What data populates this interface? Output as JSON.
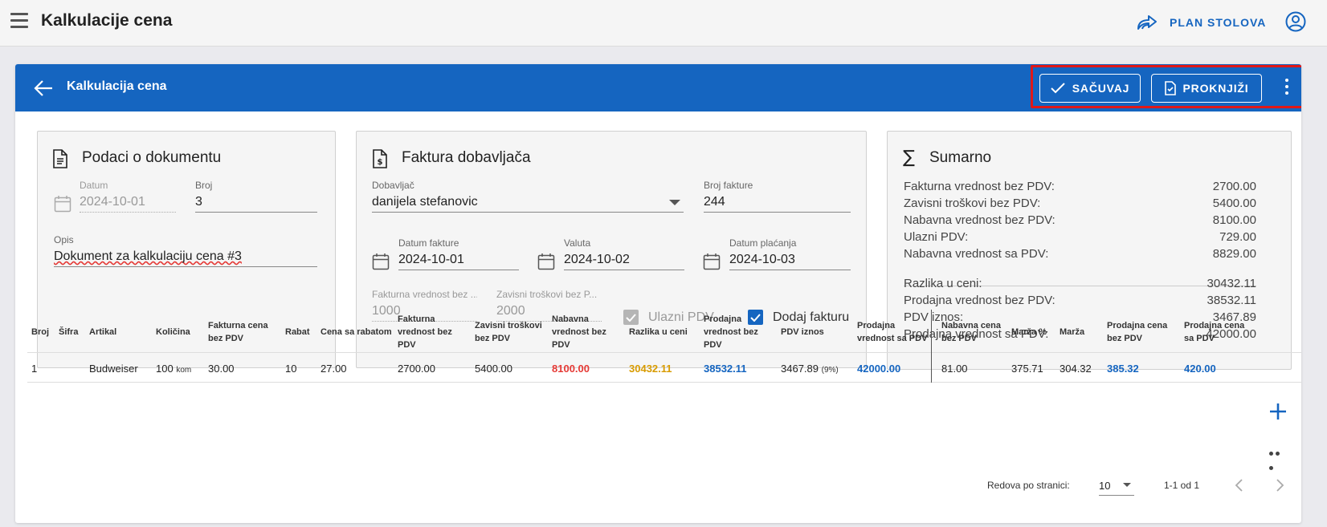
{
  "appbar": {
    "title": "Kalkulacije cena",
    "plan_label": "PLAN STOLOVA"
  },
  "header": {
    "title": "Kalkulacija cena",
    "save_label": "SAČUVAJ",
    "book_label": "PROKNJIŽI"
  },
  "doc": {
    "title": "Podaci o dokumentu",
    "datum_label": "Datum",
    "datum_value": "2024-10-01",
    "broj_label": "Broj",
    "broj_value": "3",
    "opis_label": "Opis",
    "opis_value": "Dokument za kalkulaciju cena #3"
  },
  "invoice": {
    "title": "Faktura dobavljača",
    "dobavljac_label": "Dobavljač",
    "dobavljac_value": "danijela stefanovic",
    "broj_fakture_label": "Broj fakture",
    "broj_fakture_value": "244",
    "datum_fakture_label": "Datum fakture",
    "datum_fakture_value": "2024-10-01",
    "valuta_label": "Valuta",
    "valuta_value": "2024-10-02",
    "datum_placanja_label": "Datum plaćanja",
    "datum_placanja_value": "2024-10-03",
    "fakturna_label": "Fakturna vrednost bez ...",
    "fakturna_value": "1000",
    "zavisni_label": "Zavisni troškovi bez P...",
    "zavisni_value": "2000",
    "ulazni_pdv_label": "Ulazni PDV",
    "dodaj_fakturu_label": "Dodaj fakturu"
  },
  "summary": {
    "title": "Sumarno",
    "rows": [
      {
        "label": "Fakturna vrednost bez PDV:",
        "value": "2700.00"
      },
      {
        "label": "Zavisni troškovi bez PDV:",
        "value": "5400.00"
      },
      {
        "label": "Nabavna vrednost bez PDV:",
        "value": "8100.00"
      },
      {
        "label": "Ulazni PDV:",
        "value": "729.00"
      },
      {
        "label": "Nabavna vrednost sa PDV:",
        "value": "8829.00"
      },
      {
        "label": "Razlika u ceni:",
        "value": "30432.11"
      },
      {
        "label": "Prodajna vrednost bez PDV:",
        "value": "38532.11"
      },
      {
        "label": "PDV iznos:",
        "value": "3467.89"
      },
      {
        "label": "Prodajna vrednost sa PDV:",
        "value": "42000.00"
      }
    ]
  },
  "table": {
    "headers": {
      "broj": "Broj",
      "sifra": "Šifra",
      "artikal": "Artikal",
      "kolicina": "Količina",
      "fakturna_cena_1": "Fakturna cena",
      "fakturna_cena_2": "bez PDV",
      "rabat": "Rabat",
      "cena_sa_rabatom": "Cena sa rabatom",
      "fakturna_vrednost_1": "Fakturna",
      "fakturna_vrednost_2": "vrednost bez",
      "fakturna_vrednost_3": "PDV",
      "zavisni_1": "Zavisni troškovi",
      "zavisni_2": "bez PDV",
      "nabavna_vrednost_1": "Nabavna",
      "nabavna_vrednost_2": "vrednost bez",
      "nabavna_vrednost_3": "PDV",
      "razlika": "Razlika u ceni",
      "prodajna_vrednost_1": "Prodajna",
      "prodajna_vrednost_2": "vrednost bez",
      "prodajna_vrednost_3": "PDV",
      "pdv_iznos": "PDV iznos",
      "prodajna_sa_pdv_1": "Prodajna",
      "prodajna_sa_pdv_2": "vrednost sa PDV",
      "nabavna_cena_1": "Nabavna cena",
      "nabavna_cena_2": "bez PDV",
      "marza_pct": "Marža %",
      "marza": "Marža",
      "prodajna_cena_bez_1": "Prodajna cena",
      "prodajna_cena_bez_2": "bez PDV",
      "prodajna_cena_sa_1": "Prodajna cena",
      "prodajna_cena_sa_2": "sa PDV"
    },
    "row": {
      "broj": "1",
      "sifra": "",
      "artikal": "Budweiser",
      "kolicina": "100",
      "kolicina_unit": "kom",
      "fakturna_cena": "30.00",
      "rabat": "10",
      "cena_sa_rabatom": "27.00",
      "fakturna_vrednost": "2700.00",
      "zavisni": "5400.00",
      "nabavna_vrednost": "8100.00",
      "razlika": "30432.11",
      "prodajna_vrednost": "38532.11",
      "pdv_iznos": "3467.89",
      "pdv_pct": "(9%)",
      "prodajna_sa_pdv": "42000.00",
      "nabavna_cena": "81.00",
      "marza_pct": "375.71",
      "marza": "304.32",
      "prodajna_cena_bez": "385.32",
      "prodajna_cena_sa": "420.00"
    }
  },
  "pagination": {
    "rows_per_page_label": "Redova po stranici:",
    "rows_per_page_value": "10",
    "range": "1-1 od 1"
  },
  "colors": {
    "primary": "#1565c0",
    "red_value": "#e53935",
    "orange_value": "#d89b00",
    "highlight": "#e01818"
  }
}
